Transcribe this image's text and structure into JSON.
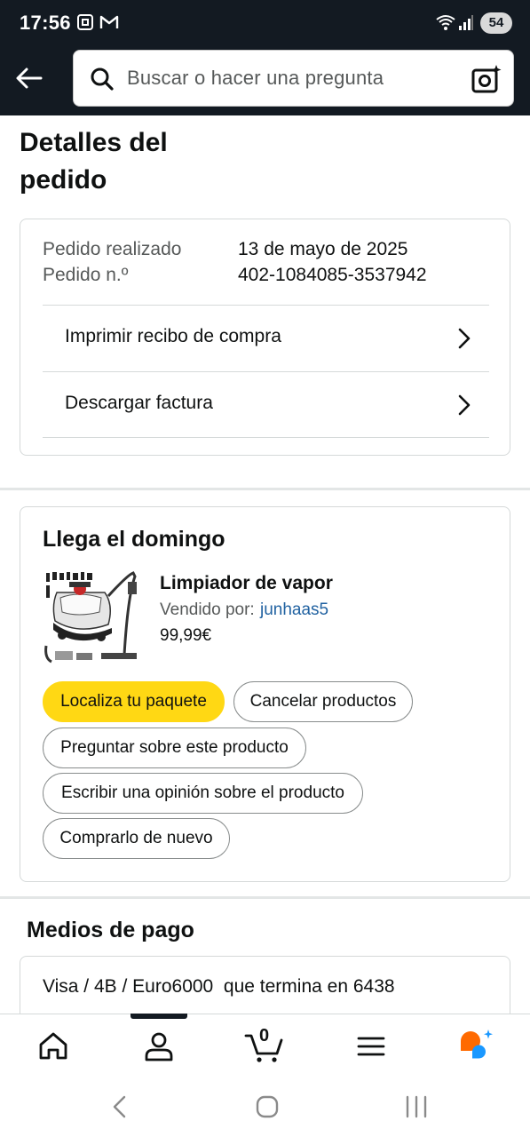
{
  "status_bar": {
    "time": "17:56",
    "battery": "54",
    "icons": [
      "screenshot-icon",
      "gmail-icon",
      "wifi-icon",
      "signal-icon"
    ]
  },
  "header": {
    "search_placeholder": "Buscar o hacer una pregunta",
    "icons": [
      "back-arrow-icon",
      "search-icon",
      "camera-search-icon"
    ]
  },
  "page": {
    "title": "Detalles del pedido"
  },
  "order_info": {
    "rows": [
      {
        "label": "Pedido realizado",
        "value": "13 de mayo de 2025"
      },
      {
        "label": "Pedido n.º",
        "value": "402-1084085-3537942"
      }
    ],
    "links": [
      {
        "label": "Imprimir recibo de compra"
      },
      {
        "label": "Descargar factura"
      }
    ]
  },
  "shipment": {
    "heading": "Llega el domingo",
    "product": {
      "name": "Limpiador de vapor",
      "sold_by_label": "Vendido por:",
      "seller": "junhaas5",
      "price": "99,99€"
    },
    "actions": {
      "track": "Localiza tu paquete",
      "cancel": "Cancelar productos",
      "ask": "Preguntar sobre este producto",
      "review": "Escribir una opinión sobre el producto",
      "buy_again": "Comprarlo de nuevo"
    }
  },
  "payment": {
    "heading": "Medios de pago",
    "method": "Visa / 4B / Euro6000  que termina en 6438"
  },
  "bottom_nav": {
    "items": [
      "home-icon",
      "account-icon",
      "cart-icon",
      "menu-icon",
      "rufus-icon"
    ],
    "cart_count": "0",
    "active_index": 1
  },
  "colors": {
    "header_bg": "#131a22",
    "primary_button": "#ffd814",
    "link": "#2162a1",
    "rufus_orange": "#ff6a00",
    "rufus_blue": "#1a98ff"
  }
}
